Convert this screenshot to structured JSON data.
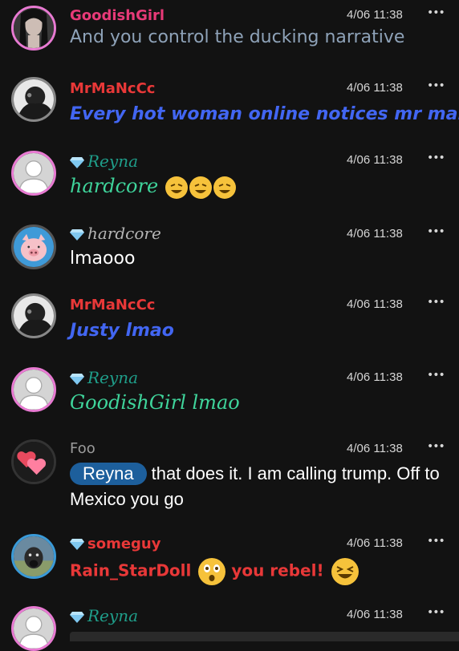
{
  "messages": [
    {
      "user": "GoodishGirl",
      "time": "4/06 11:38",
      "text": "And you control the ducking narrative",
      "name_color": "#e83a78",
      "text_color": "#8ea2b8",
      "avatar": "woman-photo-avatar",
      "premium": false
    },
    {
      "user": "MrMaNcCc",
      "time": "4/06 11:38",
      "text": "Every hot woman online notices mr manc",
      "name_color": "#e83838",
      "text_color": "#4266f2",
      "avatar": "man-photo-avatar",
      "premium": false
    },
    {
      "user": "Reyna",
      "time": "4/06 11:38",
      "text": "hardcore",
      "emojis": [
        "rofl",
        "rofl",
        "rofl"
      ],
      "name_color": "#1f9e8a",
      "text_color": "#3fd49b",
      "avatar": "default-user-avatar",
      "premium": true
    },
    {
      "user": "hardcore",
      "time": "4/06 11:38",
      "text": "lmaooo",
      "name_color": "#b5b5b5",
      "text_color": "#ffffff",
      "avatar": "pig-avatar",
      "premium": true
    },
    {
      "user": "MrMaNcCc",
      "time": "4/06 11:38",
      "text": "Justy lmao",
      "name_color": "#e83838",
      "text_color": "#4266f2",
      "avatar": "man-photo-avatar",
      "premium": false
    },
    {
      "user": "Reyna",
      "time": "4/06 11:38",
      "text": "GoodishGirl lmao",
      "name_color": "#1f9e8a",
      "text_color": "#3fd49b",
      "avatar": "default-user-avatar",
      "premium": true
    },
    {
      "user": "Foo",
      "time": "4/06 11:38",
      "mention": "Reyna",
      "text": "that does it. I am calling trump. Off to",
      "text2": "Mexico you go",
      "name_color": "#9a9a9a",
      "text_color": "#ffffff",
      "avatar": "hearts-avatar",
      "premium": false
    },
    {
      "user": "someguy",
      "time": "4/06 11:38",
      "text": "Rain_StarDoll",
      "emoji_mid": "astonished",
      "text_b": "you rebel!",
      "emoji_end": "laughing",
      "name_color": "#e83838",
      "text_color": "#e83838",
      "avatar": "dog-photo-avatar",
      "premium": true
    },
    {
      "user": "Reyna",
      "time": "4/06 11:38",
      "name_color": "#1f9e8a",
      "avatar": "default-user-avatar",
      "premium": true
    }
  ],
  "menu_icon": "more-dots-icon",
  "premium_icon": "diamond-icon"
}
